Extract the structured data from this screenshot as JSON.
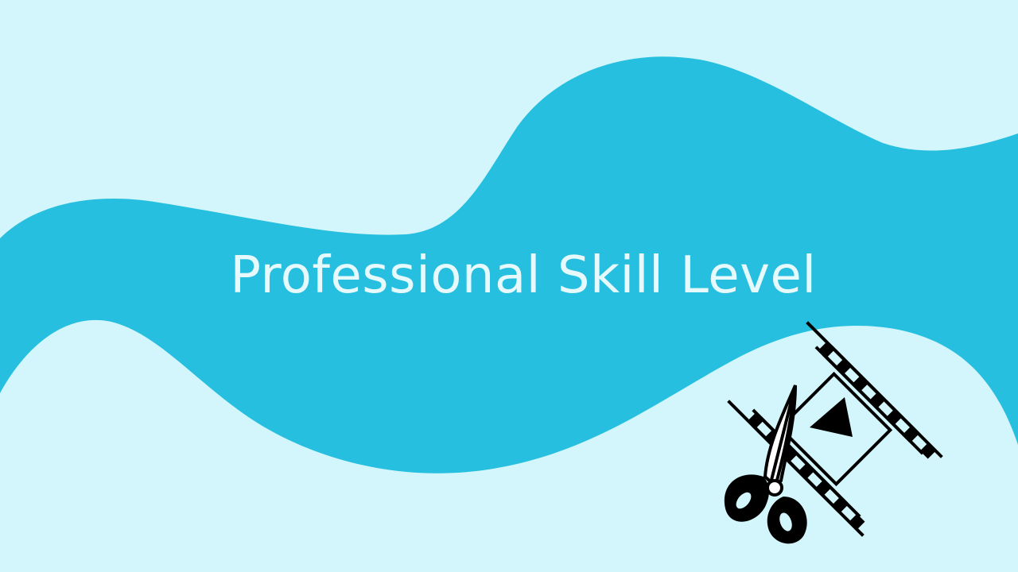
{
  "slide": {
    "title": "Professional Skill Level",
    "background_color": "#d3f6fc",
    "wave_color": "#26bfdf",
    "title_color": "#e6f9fc"
  },
  "illustration": {
    "icon": "film-strip-with-scissors-icon"
  }
}
